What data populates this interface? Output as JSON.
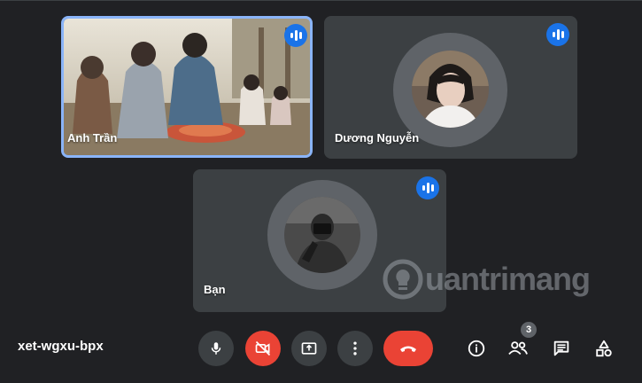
{
  "participants": [
    {
      "name": "Anh Trần",
      "speaking": true,
      "active": true
    },
    {
      "name": "Dương Nguyễn",
      "speaking": true,
      "active": false
    },
    {
      "name": "Bạn",
      "speaking": true,
      "active": false
    }
  ],
  "meeting": {
    "code": "xet-wgxu-bpx"
  },
  "controls": {
    "mic": "microphone-icon",
    "camera": "camera-off-icon",
    "present": "present-screen-icon",
    "more": "more-options-icon",
    "leave": "end-call-icon"
  },
  "side": {
    "people_count": "3"
  },
  "watermark": {
    "text": "uantrimang"
  },
  "colors": {
    "accent": "#1a73e8",
    "danger": "#ea4335",
    "tile": "#3c4043",
    "background": "#202124",
    "active_border": "#8ab4f8"
  }
}
